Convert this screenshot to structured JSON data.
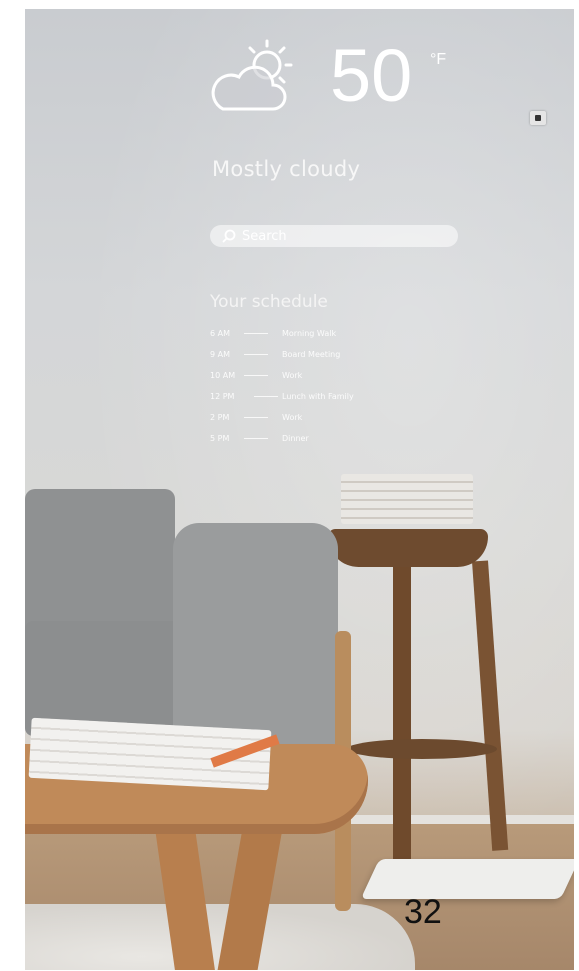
{
  "weather": {
    "icon": "partly-cloudy-icon",
    "temperature": "50",
    "unit": "°F",
    "condition": "Mostly cloudy"
  },
  "search": {
    "icon": "search-icon",
    "placeholder": "Search"
  },
  "schedule": {
    "title": "Your schedule",
    "items": [
      {
        "time": "6 AM",
        "event": "Morning Walk"
      },
      {
        "time": "9 AM",
        "event": "Board Meeting"
      },
      {
        "time": "10 AM",
        "event": "Work"
      },
      {
        "time": "12 PM",
        "event": "Lunch with Family"
      },
      {
        "time": "2 PM",
        "event": "Work"
      },
      {
        "time": "5 PM",
        "event": "Dinner"
      }
    ]
  },
  "page_number": "32"
}
